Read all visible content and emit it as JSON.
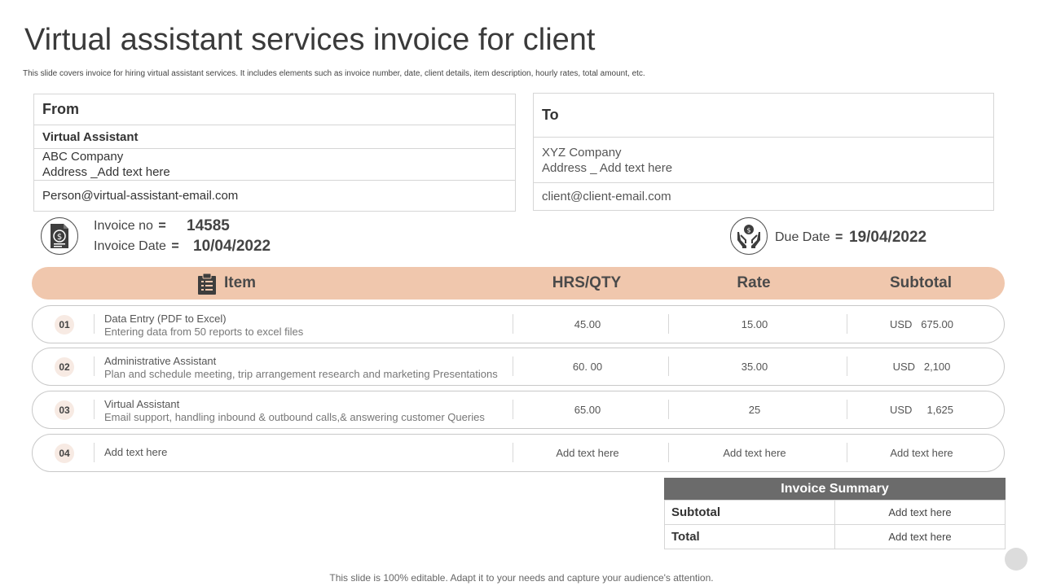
{
  "title": "Virtual assistant services invoice for client",
  "subtitle": "This slide covers invoice for hiring virtual assistant services. It includes elements such as invoice number, date, client details, item description, hourly rates, total amount,  etc.",
  "from": {
    "heading": "From",
    "name": "Virtual Assistant",
    "company": "ABC Company",
    "address": "Address _Add text here",
    "email": "Person@virtual-assistant-email.com"
  },
  "to": {
    "heading": "To",
    "company": "XYZ  Company",
    "address": "Address _ Add text  here",
    "email": "client@client-email.com"
  },
  "invoice": {
    "no_label": "Invoice no",
    "no_value": "14585",
    "date_label": "Invoice  Date",
    "date_value": "10/04/2022",
    "due_label": "Due Date",
    "due_value": "19/04/2022",
    "equals": "="
  },
  "table": {
    "headers": {
      "item": "Item",
      "qty": "HRS/QTY",
      "rate": "Rate",
      "subtotal": "Subtotal"
    },
    "rows": [
      {
        "num": "01",
        "title": "Data Entry (PDF to Excel)",
        "desc": "Entering data from  50 reports to excel files",
        "qty": "45.00",
        "rate": "15.00",
        "subtotal": "USD   675.00"
      },
      {
        "num": "02",
        "title": "Administrative Assistant",
        "desc": "Plan and schedule meeting, trip arrangement  research and marketing Presentations",
        "qty": "60. 00",
        "rate": "35.00",
        "subtotal": "USD   2,100"
      },
      {
        "num": "03",
        "title": "Virtual Assistant",
        "desc": "Email support, handling inbound  & outbound  calls,& answering customer Queries",
        "qty": "65.00",
        "rate": "25",
        "subtotal": "USD     1,625"
      },
      {
        "num": "04",
        "title": "Add text here",
        "desc": "",
        "qty": "Add text here",
        "rate": "Add text here",
        "subtotal": "Add text here"
      }
    ]
  },
  "summary": {
    "heading": "Invoice Summary",
    "subtotal_label": "Subtotal",
    "subtotal_value": "Add text here",
    "total_label": "Total",
    "total_value": "Add text here"
  },
  "footer": "This slide is 100% editable. Adapt it to your needs and capture your audience's attention.",
  "colors": {
    "header_bar": "#f0c7ad",
    "summary_head": "#6b6b6b",
    "number_badge": "#f7eae3"
  },
  "icons": {
    "invoice": "dollar-document-icon",
    "due": "money-hands-icon",
    "item": "clipboard-icon"
  }
}
